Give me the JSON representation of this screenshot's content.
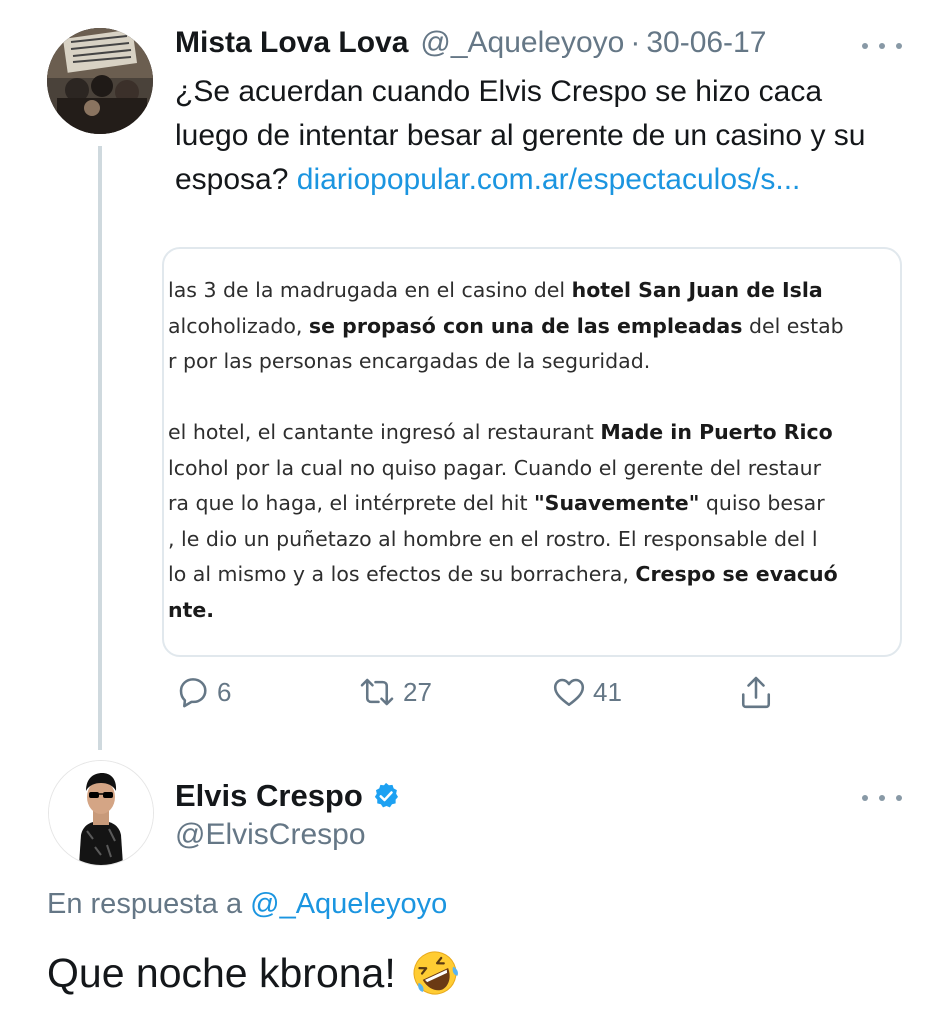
{
  "tweet1": {
    "display_name": "Mista Lova Lova",
    "handle": "@_Aqueleyoyo",
    "separator": "·",
    "date": "30-06-17",
    "text": "¿Se acuerdan cuando Elvis Crespo se hizo caca luego de intentar besar al gerente de un casino y su esposa? ",
    "link": "diariopopular.com.ar/espectaculos/s...",
    "card": {
      "p1_l1_a": "las 3 de la madrugada en el casino del ",
      "p1_l1_b": "hotel San Juan de Isla",
      "p1_l2_a": "alcoholizado, ",
      "p1_l2_b": "se propasó con una de las empleadas",
      "p1_l2_c": " del estab",
      "p1_l3": "r por las personas encargadas de la seguridad.",
      "p2_l1_a": "el hotel, el cantante ingresó al restaurant ",
      "p2_l1_b": "Made in Puerto Rico",
      "p2_l2": "lcohol por la cual no quiso pagar. Cuando el gerente del restaur",
      "p2_l3_a": "ra que lo haga, el intérprete del hit ",
      "p2_l3_b": "\"Suavemente\"",
      "p2_l3_c": " quiso besar",
      "p2_l4": ", le dio un puñetazo al hombre en el rostro. El responsable del l",
      "p2_l5_a": "lo al mismo y a los efectos de su borrachera, ",
      "p2_l5_b": "Crespo se evacuó",
      "p2_l6": "nte."
    },
    "actions": {
      "replies": "6",
      "retweets": "27",
      "likes": "41"
    }
  },
  "tweet2": {
    "display_name": "Elvis Crespo",
    "handle": "@ElvisCrespo",
    "reply_prefix": "En respuesta a ",
    "reply_handle": "@_Aqueleyoyo",
    "text": "Que noche kbrona!"
  },
  "colors": {
    "link": "#1b95e0",
    "secondary_text": "#657786",
    "verified": "#1da1f2",
    "thread_line": "#cfd9de"
  },
  "icons": [
    "reply-icon",
    "retweet-icon",
    "like-icon",
    "share-icon",
    "verified-badge-icon",
    "more-icon",
    "rolling-laughing-emoji"
  ]
}
